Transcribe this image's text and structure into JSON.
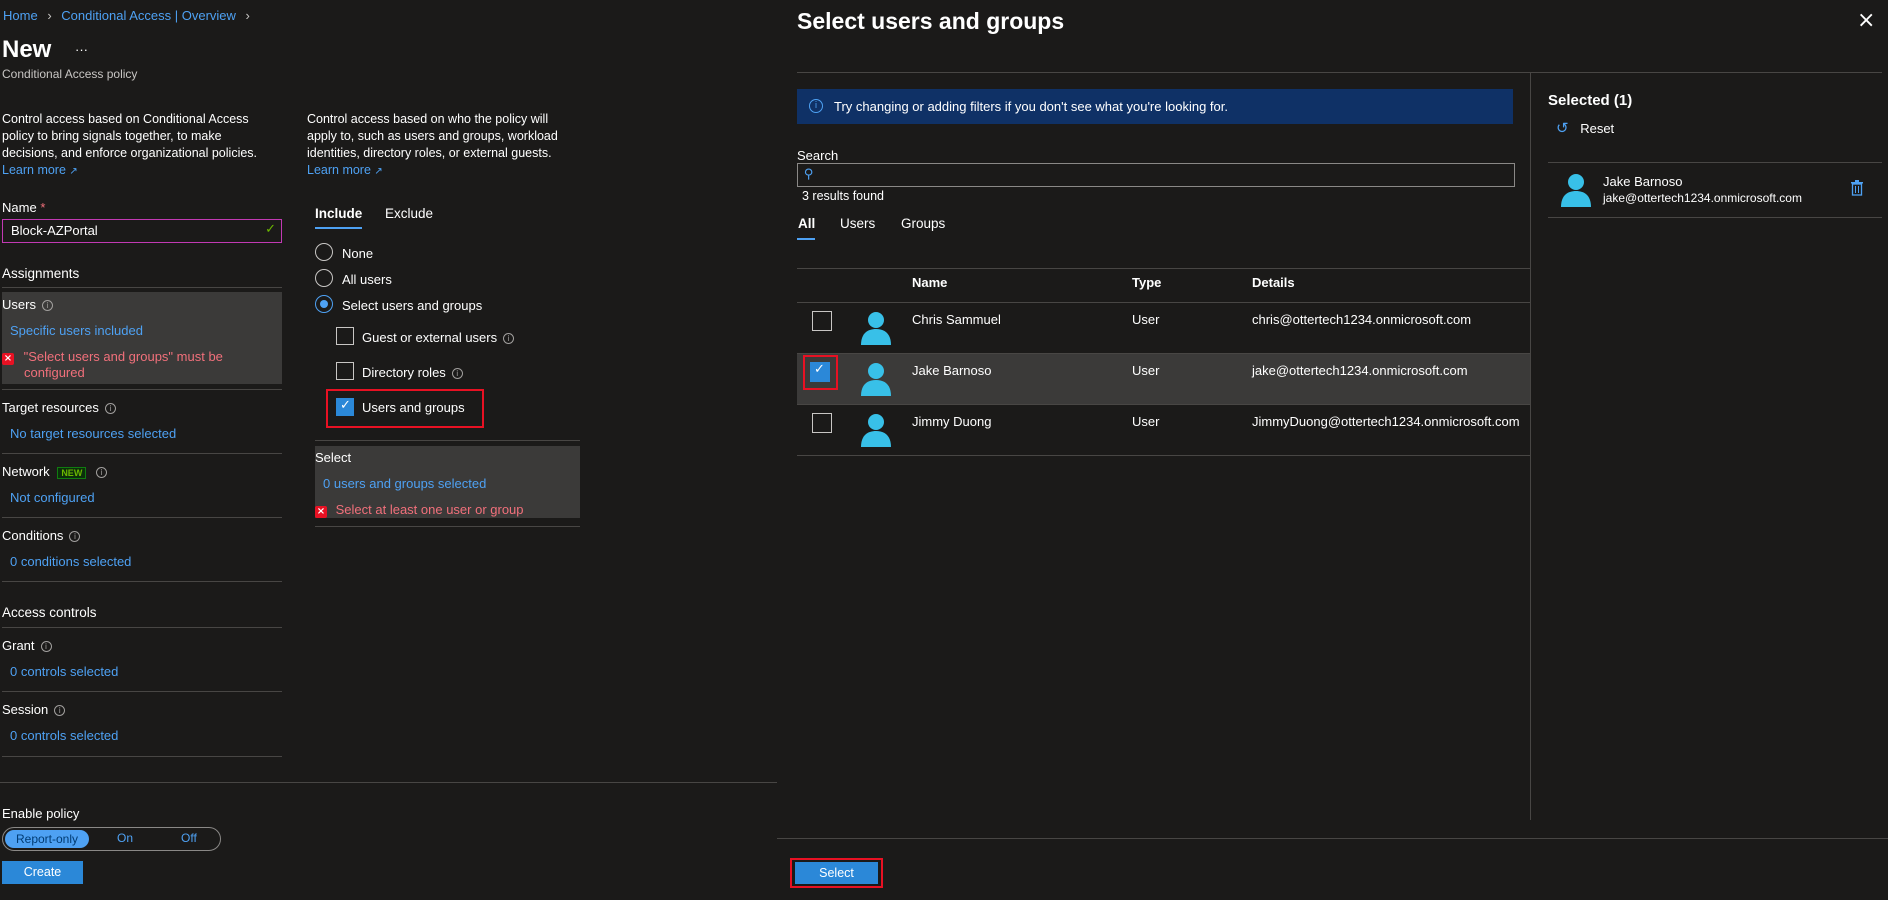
{
  "breadcrumb": {
    "home": "Home",
    "parent": "Conditional Access | Overview"
  },
  "page": {
    "title": "New",
    "more": "···",
    "subtitle": "Conditional Access policy"
  },
  "left": {
    "intro": [
      "Control access based on Conditional Access",
      "policy to bring signals together, to make",
      "decisions, and enforce organizational policies."
    ],
    "learn_more": "Learn more",
    "name_label": "Name",
    "name_required": "*",
    "name_value": "Block-AZPortal",
    "assignments_heading": "Assignments",
    "users_label": "Users",
    "users_value": "Specific users included",
    "users_error": [
      "\"Select users and groups\" must be",
      "configured"
    ],
    "target_label": "Target resources",
    "target_value": "No target resources selected",
    "network_label": "Network",
    "network_badge": "NEW",
    "network_value": "Not configured",
    "conditions_label": "Conditions",
    "conditions_value": "0 conditions selected",
    "access_heading": "Access controls",
    "grant_label": "Grant",
    "grant_value": "0 controls selected",
    "session_label": "Session",
    "session_value": "0 controls selected",
    "enable_label": "Enable policy",
    "toggle": [
      "Report-only",
      "On",
      "Off"
    ],
    "create_label": "Create"
  },
  "middle": {
    "intro": [
      "Control access based on who the policy will",
      "apply to, such as users and groups, workload",
      "identities, directory roles, or external guests."
    ],
    "learn_more": "Learn more",
    "tabs": [
      "Include",
      "Exclude"
    ],
    "radios": [
      "None",
      "All users",
      "Select users and groups"
    ],
    "checks": [
      "Guest or external users",
      "Directory roles",
      "Users and groups"
    ],
    "select_label": "Select",
    "select_value": "0 users and groups selected",
    "select_error": "Select at least one user or group"
  },
  "dialog": {
    "title": "Select users and groups",
    "info": "Try changing or adding filters if you don't see what you're looking for.",
    "search_label": "Search",
    "results": "3 results found",
    "filters": [
      "All",
      "Users",
      "Groups"
    ],
    "columns": [
      "Name",
      "Type",
      "Details"
    ],
    "rows": [
      {
        "name": "Chris Sammuel",
        "type": "User",
        "details": "chris@ottertech1234.onmicrosoft.com",
        "checked": false
      },
      {
        "name": "Jake Barnoso",
        "type": "User",
        "details": "jake@ottertech1234.onmicrosoft.com",
        "checked": true
      },
      {
        "name": "Jimmy Duong",
        "type": "User",
        "details": "JimmyDuong@ottertech1234.onmicrosoft.com",
        "checked": false
      }
    ],
    "selected_heading": "Selected (1)",
    "reset_label": "Reset",
    "selected_user": {
      "name": "Jake Barnoso",
      "email": "jake@ottertech1234.onmicrosoft.com"
    },
    "select_button": "Select"
  },
  "colors": {
    "accent": "#2b88d8",
    "link": "#4ea1f3",
    "error": "#f1707b",
    "info_bar": "#0f3166"
  }
}
